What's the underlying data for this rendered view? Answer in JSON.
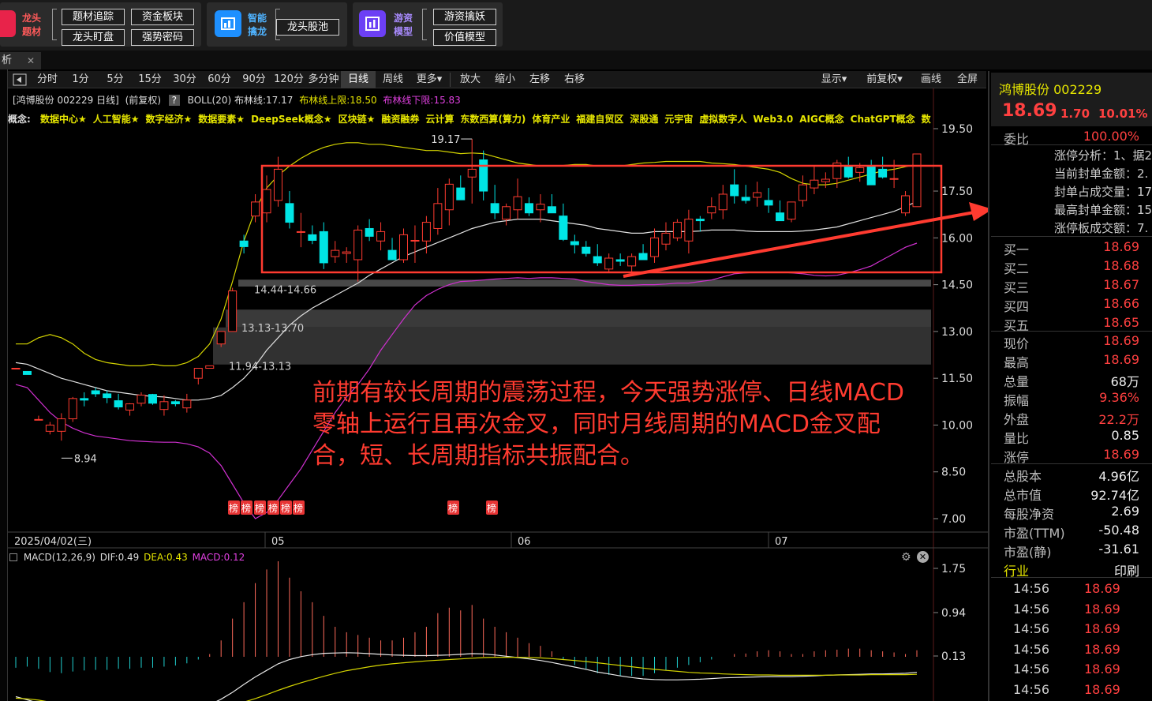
{
  "topbar": {
    "group1": {
      "name_lines": [
        "龙头",
        "题材"
      ],
      "buttons": [
        "题材追踪",
        "资金板块",
        "龙头盯盘",
        "强势密码"
      ]
    },
    "group2": {
      "name_lines": [
        "智能",
        "擒龙"
      ],
      "buttons": [
        "龙头股池"
      ]
    },
    "group3": {
      "name_lines": [
        "游资",
        "模型"
      ],
      "buttons": [
        "游资擒妖",
        "价值模型"
      ]
    }
  },
  "tab": {
    "label": "析",
    "close": "✕"
  },
  "toolbar": {
    "periods": [
      "分时",
      "1分",
      "5分",
      "15分",
      "30分",
      "60分",
      "90分",
      "120分",
      "多分钟",
      "日线",
      "周线",
      "更多▾"
    ],
    "selected": "日线",
    "actions": [
      "放大",
      "缩小",
      "左移",
      "右移"
    ],
    "right": [
      "显示▾",
      "前复权▾",
      "画线",
      "全屏"
    ]
  },
  "chart_header": {
    "stock": "[鸿博股份 002229 日线]",
    "adjust": "(前复权)",
    "help": "?",
    "boll_label": "BOLL(20) 布林线:17.17",
    "boll_upper": "布林线上限:18.50",
    "boll_lower": "布林线下限:15.83"
  },
  "concepts": {
    "prefix": "概念:",
    "items": [
      "数据中心★",
      "人工智能★",
      "数字经济★",
      "数据要素★",
      "DeepSeek概念★",
      "区块链★",
      "融资融券",
      "云计算",
      "东数西算(算力)",
      "体育产业",
      "福建自贸区",
      "深股通",
      "元宇宙",
      "虚拟数字人",
      "Web3.0",
      "AIGC概念",
      "ChatGPT概念",
      "数字"
    ]
  },
  "price_axis": [
    "19.50",
    "17.50",
    "16.00",
    "14.50",
    "13.00",
    "11.50",
    "10.00",
    "8.50",
    "7.00"
  ],
  "zones": [
    "14.44-14.66",
    "13.13-13.70",
    "11.94-13.13"
  ],
  "markers": {
    "high": "19.17",
    "low": "8.94",
    "badge": "榜"
  },
  "date_axis": {
    "cursor": "2025/04/02(三)",
    "months": [
      "05",
      "06",
      "07"
    ]
  },
  "annotation": {
    "lines": [
      "前期有较长周期的震荡过程，今天强势涨停、日线MACD",
      "零轴上运行且再次金叉，同时月线周期的MACD金叉配",
      "合，短、长周期指标共振配合。"
    ],
    "color": "#ff3b30"
  },
  "macd": {
    "label": "MACD(12,26,9)",
    "dif": "DIF:0.49",
    "dea": "DEA:0.43",
    "value": "MACD:0.12",
    "axis": [
      "1.75",
      "0.94",
      "0.13"
    ]
  },
  "chart_data": {
    "type": "candlestick",
    "title": "鸿博股份 002229 日线",
    "ylim": [
      7.0,
      19.5
    ],
    "candles": [
      [
        11.82,
        11.82,
        11.82,
        11.82
      ],
      [
        11.72,
        11.72,
        11.62,
        11.62
      ],
      [
        10.18,
        10.3,
        10.15,
        10.18
      ],
      [
        9.8,
        10.1,
        9.7,
        10.0
      ],
      [
        9.8,
        10.38,
        9.5,
        10.2
      ],
      [
        10.2,
        10.9,
        10.1,
        10.85
      ],
      [
        10.85,
        11.05,
        10.6,
        10.8
      ],
      [
        11.1,
        11.2,
        10.9,
        11.0
      ],
      [
        11.0,
        11.1,
        10.7,
        10.88
      ],
      [
        10.78,
        11.0,
        10.5,
        10.58
      ],
      [
        10.48,
        10.7,
        10.3,
        10.68
      ],
      [
        10.7,
        11.05,
        10.6,
        10.96
      ],
      [
        10.98,
        11.0,
        10.65,
        10.7
      ],
      [
        10.5,
        10.95,
        10.3,
        10.75
      ],
      [
        10.75,
        10.8,
        10.6,
        10.68
      ],
      [
        10.55,
        11.0,
        10.4,
        10.8
      ],
      [
        11.5,
        11.82,
        11.3,
        11.82
      ],
      [
        11.82,
        11.9,
        11.82,
        11.9
      ],
      [
        12.6,
        13.0,
        12.5,
        13.0
      ],
      [
        13.0,
        14.4,
        13.0,
        14.3
      ],
      [
        15.9,
        16.1,
        15.5,
        15.72
      ],
      [
        16.7,
        17.4,
        16.5,
        17.15
      ],
      [
        16.8,
        18.0,
        16.5,
        17.55
      ],
      [
        17.2,
        18.6,
        17.0,
        18.2
      ],
      [
        17.1,
        17.5,
        16.3,
        16.5
      ],
      [
        16.2,
        16.8,
        15.7,
        16.2
      ],
      [
        16.1,
        16.4,
        15.8,
        15.92
      ],
      [
        16.2,
        16.5,
        15.0,
        15.2
      ],
      [
        15.4,
        15.9,
        15.2,
        15.6
      ],
      [
        15.5,
        15.7,
        15.2,
        15.55
      ],
      [
        15.3,
        16.4,
        14.6,
        16.25
      ],
      [
        16.3,
        16.6,
        15.9,
        16.05
      ],
      [
        15.9,
        16.5,
        15.6,
        16.2
      ],
      [
        15.6,
        16.0,
        15.3,
        15.3
      ],
      [
        15.3,
        16.3,
        15.2,
        16.1
      ],
      [
        15.9,
        16.4,
        15.2,
        15.92
      ],
      [
        15.9,
        16.7,
        15.5,
        16.5
      ],
      [
        16.3,
        17.6,
        16.1,
        17.1
      ],
      [
        16.9,
        17.9,
        16.4,
        17.72
      ],
      [
        17.6,
        18.0,
        17.3,
        17.22
      ],
      [
        17.95,
        19.17,
        17.1,
        18.2
      ],
      [
        18.5,
        18.8,
        17.2,
        17.5
      ],
      [
        17.1,
        17.7,
        16.6,
        16.8
      ],
      [
        16.6,
        17.1,
        16.4,
        17.0
      ],
      [
        16.9,
        17.9,
        16.6,
        17.32
      ],
      [
        17.1,
        17.3,
        16.7,
        16.8
      ],
      [
        16.9,
        17.4,
        16.5,
        17.08
      ],
      [
        17.0,
        17.4,
        16.8,
        16.8
      ],
      [
        16.7,
        17.1,
        15.9,
        15.95
      ],
      [
        15.88,
        16.1,
        15.5,
        15.78
      ],
      [
        15.7,
        15.9,
        15.4,
        15.5
      ],
      [
        15.4,
        15.8,
        15.1,
        15.2
      ],
      [
        15.0,
        15.5,
        14.9,
        15.35
      ],
      [
        15.3,
        15.5,
        15.1,
        15.25
      ],
      [
        15.1,
        15.5,
        14.9,
        15.4
      ],
      [
        15.5,
        15.8,
        15.3,
        15.3
      ],
      [
        15.4,
        16.3,
        15.2,
        16.0
      ],
      [
        15.8,
        16.5,
        15.6,
        16.15
      ],
      [
        16.0,
        16.6,
        15.9,
        16.5
      ],
      [
        15.9,
        16.9,
        15.5,
        16.6
      ],
      [
        16.6,
        16.7,
        16.2,
        16.55
      ],
      [
        16.8,
        17.3,
        16.6,
        17.0
      ],
      [
        16.9,
        17.7,
        16.6,
        17.4
      ],
      [
        17.7,
        18.2,
        17.1,
        17.35
      ],
      [
        17.3,
        17.7,
        17.1,
        17.2
      ],
      [
        17.3,
        17.8,
        17.0,
        17.45
      ],
      [
        17.2,
        17.6,
        16.8,
        17.05
      ],
      [
        16.8,
        17.2,
        16.6,
        16.55
      ],
      [
        16.6,
        17.1,
        16.5,
        17.15
      ],
      [
        17.2,
        18.0,
        17.0,
        17.7
      ],
      [
        17.6,
        18.3,
        17.4,
        17.85
      ],
      [
        17.8,
        18.1,
        17.6,
        17.88
      ],
      [
        17.9,
        18.5,
        17.6,
        18.4
      ],
      [
        18.3,
        18.6,
        17.9,
        17.95
      ],
      [
        18.1,
        18.4,
        17.8,
        18.25
      ],
      [
        18.3,
        18.5,
        17.7,
        17.7
      ],
      [
        18.2,
        18.6,
        17.9,
        17.95
      ],
      [
        17.9,
        18.5,
        17.6,
        17.9
      ],
      [
        16.8,
        17.5,
        16.7,
        17.35
      ],
      [
        17.0,
        18.69,
        17.0,
        18.69
      ]
    ],
    "boll_upper": [
      12.6,
      12.6,
      12.8,
      12.9,
      12.8,
      12.6,
      12.3,
      12.1,
      12.0,
      11.95,
      11.9,
      11.9,
      11.95,
      11.9,
      11.9,
      12.0,
      12.2,
      12.6,
      13.4,
      14.6,
      15.9,
      16.9,
      17.6,
      18.0,
      18.3,
      18.55,
      18.75,
      18.9,
      19.0,
      19.05,
      19.05,
      19.0,
      19.0,
      18.95,
      18.9,
      18.85,
      18.8,
      18.8,
      18.75,
      18.7,
      18.72,
      18.7,
      18.6,
      18.5,
      18.4,
      18.35,
      18.3,
      18.3,
      18.32,
      18.35,
      18.35,
      18.3,
      18.3,
      18.3,
      18.35,
      18.4,
      18.42,
      18.45,
      18.45,
      18.45,
      18.45,
      18.4,
      18.38,
      18.35,
      18.3,
      18.25,
      18.2,
      18.1,
      17.9,
      17.75,
      17.7,
      17.7,
      17.75,
      17.85,
      17.95,
      18.05,
      18.15,
      18.2,
      18.28,
      18.35
    ],
    "boll_mid": [
      12.0,
      11.95,
      11.8,
      11.65,
      11.5,
      11.4,
      11.3,
      11.2,
      11.1,
      11.05,
      11.0,
      10.95,
      10.92,
      10.9,
      10.85,
      10.8,
      10.8,
      10.85,
      10.95,
      11.2,
      11.5,
      11.9,
      12.4,
      12.8,
      13.2,
      13.5,
      13.75,
      13.95,
      14.15,
      14.35,
      14.55,
      14.8,
      15.0,
      15.2,
      15.4,
      15.55,
      15.7,
      15.85,
      16.0,
      16.15,
      16.3,
      16.4,
      16.5,
      16.55,
      16.6,
      16.6,
      16.6,
      16.55,
      16.5,
      16.45,
      16.4,
      16.3,
      16.25,
      16.2,
      16.15,
      16.15,
      16.2,
      16.2,
      16.2,
      16.2,
      16.22,
      16.25,
      16.25,
      16.25,
      16.22,
      16.2,
      16.2,
      16.2,
      16.2,
      16.22,
      16.25,
      16.3,
      16.35,
      16.45,
      16.55,
      16.65,
      16.75,
      16.85,
      17.0,
      17.17
    ],
    "boll_lower": [
      11.3,
      11.2,
      10.8,
      10.4,
      10.1,
      9.9,
      9.75,
      9.65,
      9.6,
      9.55,
      9.5,
      9.48,
      9.46,
      9.45,
      9.45,
      9.4,
      9.3,
      9.1,
      8.7,
      8.1,
      7.5,
      7.0,
      7.2,
      7.6,
      8.1,
      8.6,
      9.2,
      9.8,
      10.4,
      10.9,
      11.3,
      11.8,
      12.4,
      12.9,
      13.4,
      13.85,
      14.15,
      14.35,
      14.5,
      14.6,
      14.62,
      14.65,
      14.68,
      14.7,
      14.72,
      14.7,
      14.72,
      14.72,
      14.7,
      14.68,
      14.6,
      14.55,
      14.5,
      14.48,
      14.48,
      14.5,
      14.5,
      14.52,
      14.55,
      14.55,
      14.6,
      14.65,
      14.75,
      14.85,
      14.88,
      14.9,
      14.9,
      14.9,
      14.88,
      14.85,
      14.8,
      14.78,
      14.8,
      14.88,
      14.98,
      15.1,
      15.3,
      15.5,
      15.7,
      15.83
    ],
    "macd_axis": [
      0.13,
      0.94,
      1.75
    ],
    "macd_hist": [
      -0.2,
      -0.18,
      -0.22,
      -0.28,
      -0.3,
      -0.27,
      -0.25,
      -0.24,
      -0.24,
      -0.22,
      -0.22,
      -0.2,
      -0.2,
      -0.18,
      -0.16,
      -0.12,
      -0.05,
      0.05,
      0.3,
      0.7,
      1.0,
      1.35,
      1.6,
      1.75,
      1.45,
      1.2,
      1.0,
      0.75,
      0.55,
      0.45,
      0.4,
      0.35,
      0.3,
      0.3,
      0.35,
      0.45,
      0.55,
      0.8,
      0.9,
      0.85,
      0.95,
      0.7,
      0.55,
      0.45,
      0.35,
      0.25,
      0.2,
      0.1,
      -0.05,
      -0.15,
      -0.22,
      -0.3,
      -0.33,
      -0.35,
      -0.35,
      -0.35,
      -0.3,
      -0.25,
      -0.2,
      -0.15,
      -0.1,
      -0.05,
      0.0,
      0.05,
      0.06,
      0.1,
      0.12,
      0.1,
      0.05,
      0.05,
      0.1,
      0.12,
      0.13,
      0.15,
      0.15,
      0.12,
      0.1,
      0.08,
      0.05,
      0.12
    ],
    "macd_dif": [
      -0.25,
      -0.35,
      -0.45,
      -0.55,
      -0.62,
      -0.66,
      -0.68,
      -0.7,
      -0.71,
      -0.72,
      -0.72,
      -0.72,
      -0.71,
      -0.7,
      -0.69,
      -0.66,
      -0.6,
      -0.5,
      -0.33,
      -0.12,
      0.12,
      0.35,
      0.55,
      0.75,
      0.88,
      0.97,
      1.03,
      1.07,
      1.08,
      1.09,
      1.08,
      1.06,
      1.04,
      1.02,
      1.01,
      1.0,
      1.0,
      1.01,
      1.02,
      1.04,
      1.06,
      1.05,
      1.02,
      0.98,
      0.94,
      0.9,
      0.85,
      0.79,
      0.72,
      0.65,
      0.58,
      0.5,
      0.44,
      0.38,
      0.33,
      0.29,
      0.27,
      0.26,
      0.26,
      0.27,
      0.28,
      0.3,
      0.32,
      0.33,
      0.34,
      0.35,
      0.36,
      0.36,
      0.36,
      0.37,
      0.38,
      0.4,
      0.41,
      0.42,
      0.43,
      0.44,
      0.44,
      0.45,
      0.46,
      0.49
    ],
    "macd_dea": [
      -0.3,
      -0.32,
      -0.36,
      -0.42,
      -0.47,
      -0.52,
      -0.56,
      -0.59,
      -0.62,
      -0.64,
      -0.66,
      -0.67,
      -0.68,
      -0.68,
      -0.69,
      -0.68,
      -0.67,
      -0.64,
      -0.59,
      -0.52,
      -0.42,
      -0.31,
      -0.19,
      -0.06,
      0.06,
      0.17,
      0.27,
      0.37,
      0.46,
      0.54,
      0.6,
      0.66,
      0.71,
      0.75,
      0.78,
      0.81,
      0.84,
      0.86,
      0.88,
      0.9,
      0.92,
      0.94,
      0.95,
      0.95,
      0.95,
      0.94,
      0.93,
      0.91,
      0.88,
      0.85,
      0.82,
      0.78,
      0.74,
      0.7,
      0.66,
      0.62,
      0.58,
      0.55,
      0.52,
      0.49,
      0.47,
      0.46,
      0.44,
      0.43,
      0.42,
      0.41,
      0.41,
      0.4,
      0.4,
      0.4,
      0.4,
      0.4,
      0.41,
      0.41,
      0.41,
      0.42,
      0.42,
      0.42,
      0.42,
      0.43
    ]
  },
  "quote": {
    "name": "鸿博股份 002229",
    "price": "18.69",
    "change": "1.70",
    "pct": "10.01%",
    "weibi_label": "委比",
    "weibi_value": "100.00%",
    "limit_lines": [
      "涨停分析：1、据2",
      "当前封单金额：2.",
      "封单占成交量：17",
      "最高封单金额：15",
      "涨停板成交额：7."
    ],
    "bids": [
      {
        "label": "买一",
        "price": "18.69"
      },
      {
        "label": "买二",
        "price": "18.68"
      },
      {
        "label": "买三",
        "price": "18.67"
      },
      {
        "label": "买四",
        "price": "18.66"
      },
      {
        "label": "买五",
        "price": "18.65"
      }
    ],
    "stats": [
      {
        "label": "现价",
        "value": "18.69",
        "color": "red"
      },
      {
        "label": "最高",
        "value": "18.69",
        "color": "red"
      },
      {
        "label": "总量",
        "value": "68万",
        "color": "wht"
      },
      {
        "label": "振幅",
        "value": "9.36%",
        "color": "red"
      },
      {
        "label": "外盘",
        "value": "22.2万",
        "color": "red"
      },
      {
        "label": "量比",
        "value": "0.85",
        "color": "wht"
      },
      {
        "label": "涨停",
        "value": "18.69",
        "color": "red"
      }
    ],
    "fundamentals": [
      {
        "label": "总股本",
        "value": "4.96亿"
      },
      {
        "label": "总市值",
        "value": "92.74亿"
      },
      {
        "label": "每股净资",
        "value": "2.69"
      },
      {
        "label": "市盈(TTM)",
        "value": "-50.48"
      },
      {
        "label": "市盈(静)",
        "value": "-31.61"
      }
    ],
    "industry_label": "行业",
    "industry_value": "印刷",
    "ticks": [
      {
        "time": "14:56",
        "price": "18.69"
      },
      {
        "time": "14:56",
        "price": "18.69"
      },
      {
        "time": "14:56",
        "price": "18.69"
      },
      {
        "time": "14:56",
        "price": "18.69"
      },
      {
        "time": "14:56",
        "price": "18.69"
      },
      {
        "time": "14:56",
        "price": "18.69"
      }
    ]
  }
}
